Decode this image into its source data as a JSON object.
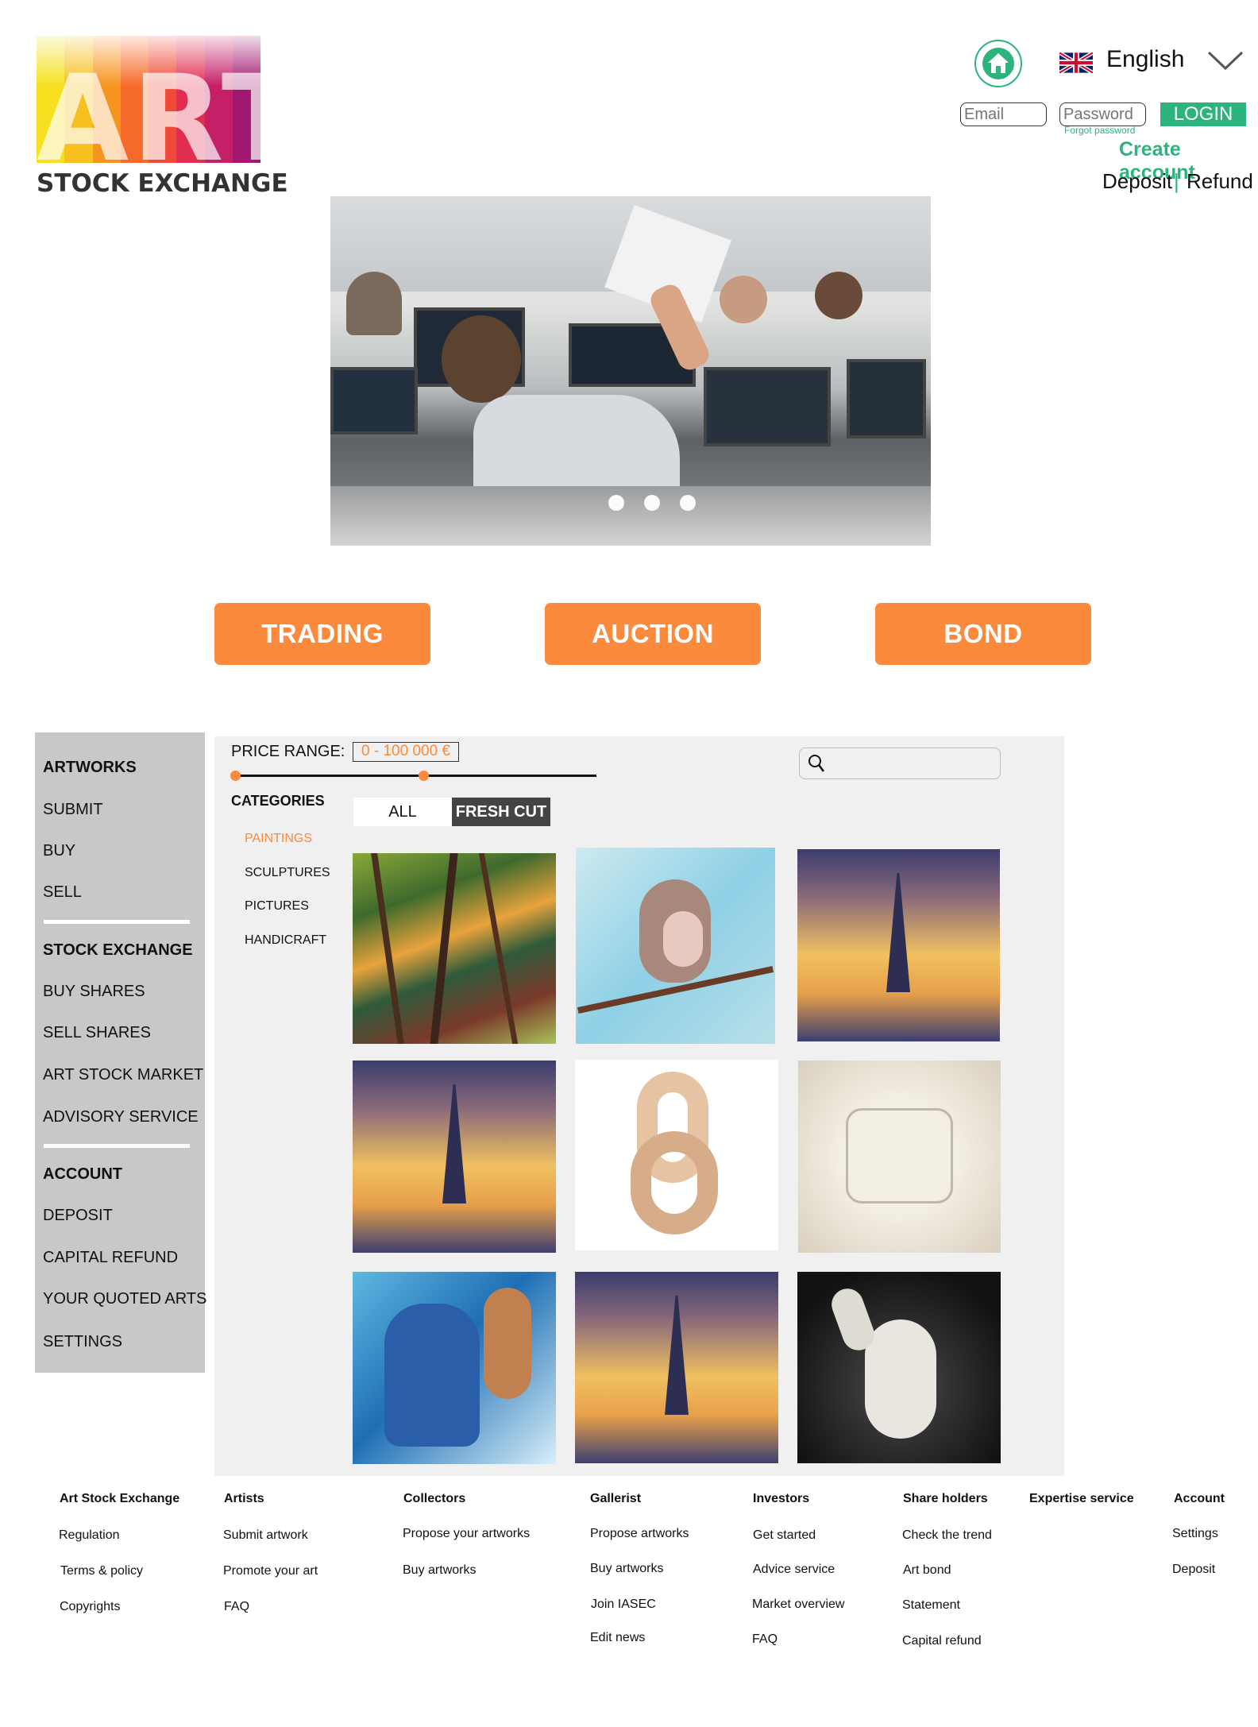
{
  "logo": {
    "letters": "ART",
    "subtitle": "STOCK EXCHANGE",
    "bar_colors": [
      "#f6e020",
      "#f7c020",
      "#f79420",
      "#f56a28",
      "#ef4a37",
      "#e12d4f",
      "#c51f68",
      "#a01870"
    ]
  },
  "header": {
    "language": "English",
    "email_placeholder": "Email",
    "password_placeholder": "Password",
    "forgot_password": "Forgot password",
    "login": "LOGIN",
    "create_account": "Create account",
    "deposit": "Deposit",
    "separator": "|",
    "refund": "Refund"
  },
  "hero": {
    "slide_count": 3
  },
  "actions": {
    "trading": "TRADING",
    "auction": "AUCTION",
    "bond": "BOND"
  },
  "sidebar": {
    "artworks": "ARTWORKS",
    "submit": "SUBMIT",
    "buy": "BUY",
    "sell": "SELL",
    "stock_exchange": "STOCK EXCHANGE",
    "buy_shares": "BUY SHARES",
    "sell_shares": "SELL SHARES",
    "art_stock_market": "ART STOCK MARKET",
    "advisory_service": "ADVISORY SERVICE",
    "account": "ACCOUNT",
    "deposit": "DEPOSIT",
    "capital_refund": "CAPITAL REFUND",
    "your_quoted_arts": "YOUR QUOTED ARTS",
    "settings": "SETTINGS"
  },
  "filters": {
    "price_label": "PRICE RANGE:",
    "price_value": "0 - 100 000 €",
    "categories_label": "CATEGORIES",
    "categories": [
      "PAINTINGS",
      "SCULPTURES",
      "PICTURES",
      "HANDICRAFT"
    ],
    "tab_all": "ALL",
    "tab_fresh_cut": "FRESH CUT"
  },
  "footer": {
    "art_stock_exchange": {
      "title": "Art Stock Exchange",
      "links": [
        "Regulation",
        "Terms & policy",
        "Copyrights"
      ]
    },
    "artists": {
      "title": "Artists",
      "links": [
        "Submit artwork",
        "Promote your art",
        "FAQ"
      ]
    },
    "collectors": {
      "title": "Collectors",
      "links": [
        "Propose your artworks",
        "Buy artworks"
      ]
    },
    "gallerist": {
      "title": "Gallerist",
      "links": [
        "Propose artworks",
        "Buy artworks",
        "Join IASEC",
        "Edit news"
      ]
    },
    "investors": {
      "title": "Investors",
      "links": [
        "Get started",
        "Advice service",
        "Market overview",
        "FAQ"
      ]
    },
    "share_holders": {
      "title": "Share holders",
      "links": [
        "Check the trend",
        "Art bond",
        "Statement",
        "Capital refund"
      ]
    },
    "expertise": {
      "title": "Expertise service"
    },
    "account": {
      "title": "Account",
      "links": [
        "Settings",
        "Deposit"
      ]
    }
  }
}
